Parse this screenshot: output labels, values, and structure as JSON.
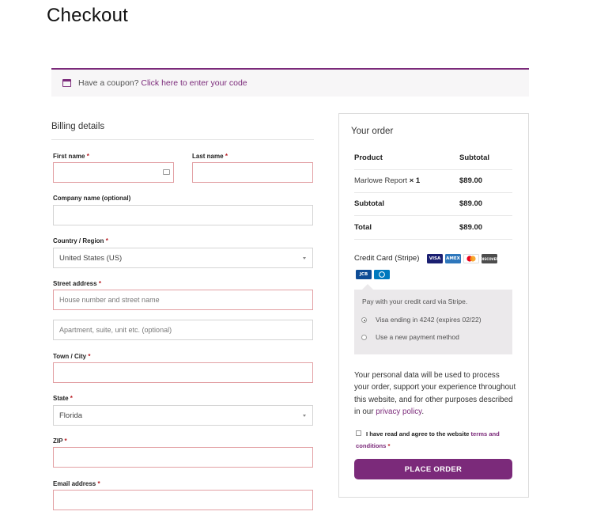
{
  "page": {
    "title": "Checkout"
  },
  "coupon": {
    "text": "Have a coupon?",
    "link": "Click here to enter your code"
  },
  "billing": {
    "title": "Billing details",
    "first_name": {
      "label": "First name",
      "req": "*"
    },
    "last_name": {
      "label": "Last name",
      "req": "*"
    },
    "company": {
      "label": "Company name (optional)"
    },
    "country": {
      "label": "Country / Region",
      "req": "*",
      "value": "United States (US)"
    },
    "street": {
      "label": "Street address",
      "req": "*",
      "placeholder": "House number and street name",
      "placeholder2": "Apartment, suite, unit etc. (optional)"
    },
    "town": {
      "label": "Town / City",
      "req": "*"
    },
    "state": {
      "label": "State",
      "req": "*",
      "value": "Florida"
    },
    "zip": {
      "label": "ZIP",
      "req": "*"
    },
    "email": {
      "label": "Email address",
      "req": "*"
    }
  },
  "order": {
    "title": "Your order",
    "header": {
      "product": "Product",
      "subtotal": "Subtotal"
    },
    "item": {
      "name": "Marlowe Report",
      "qty": "× 1",
      "price": "$89.00"
    },
    "subtotal": {
      "label": "Subtotal",
      "value": "$89.00"
    },
    "total": {
      "label": "Total",
      "value": "$89.00"
    }
  },
  "payment": {
    "method": "Credit Card (Stripe)",
    "cards": [
      "VISA",
      "AMEX",
      "MC",
      "DISCOVER",
      "JCB",
      "DINERS"
    ],
    "description": "Pay with your credit card via Stripe.",
    "saved": "Visa ending in 4242 (expires 02/22)",
    "new": "Use a new payment method"
  },
  "privacy": {
    "text": "Your personal data will be used to process your order, support your experience throughout this website, and for other purposes described in our",
    "link": "privacy policy",
    "end": "."
  },
  "terms": {
    "text": "I have read and agree to the website",
    "link": "terms and conditions",
    "req": "*"
  },
  "button": {
    "label": "PLACE ORDER"
  },
  "colors": {
    "accent": "#7b2a7a",
    "error_border": "#e2a0a4",
    "required": "#b81c23"
  }
}
